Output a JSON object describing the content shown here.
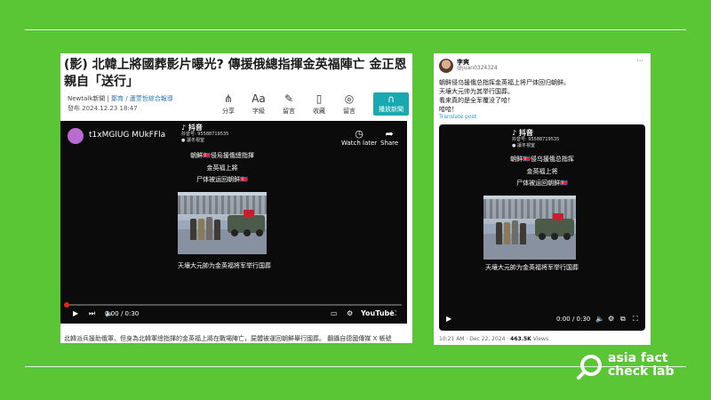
{
  "news": {
    "title": "(影) 北韓上將國葬影片曝光? 傳援俄總指揮金英福陣亡 金正恩親自「送行」",
    "source": "Newtalk新聞",
    "author_sep": " | ",
    "author": "鄭育 / 蘆萱哲綜合報導",
    "published": "發布 2024.12.23 18:47",
    "tools": [
      {
        "icon": "share-icon",
        "glyph": "⋔",
        "label": "分享"
      },
      {
        "icon": "font-size-icon",
        "glyph": "Aa",
        "label": "字級"
      },
      {
        "icon": "comment-icon",
        "glyph": "✎",
        "label": "留言"
      },
      {
        "icon": "bookmark-icon",
        "glyph": "▯",
        "label": "收藏"
      },
      {
        "icon": "message-icon",
        "glyph": "◎",
        "label": "留言"
      }
    ],
    "play_news": {
      "icon": "headphones-icon",
      "glyph": "∩",
      "label": "播放新聞"
    },
    "caption": "北韓派兵援助俄軍，但身為北韓軍總指揮的金英福上將在戰場陣亡，屍體被運回朝鮮舉行國葬。 翻攝自德國傳媒 X 帳號"
  },
  "youtube": {
    "channel": "t1xMGlUG MUkFFla",
    "watch_later": "Watch later",
    "share": "Share",
    "time": "0:00 / 0:30",
    "logo": "YouTube"
  },
  "video_overlay": {
    "platform": "抖音",
    "id_line": "抖音号: 95588719535",
    "sub_line": "● 讓冬視室",
    "caption_lines_trad": [
      "朝鮮🇰🇵侵烏援俄總指揮",
      "金英福上將",
      "尸体被运回朝鲜🇰🇵"
    ],
    "caption_lines_simp": [
      "朝鲜🇰🇵侵乌援俄总指挥",
      "金英福上将",
      "尸体被运回朝鲜🇰🇵"
    ],
    "bottom_caption": "天壤大元帥为金英福将军举行国葬"
  },
  "tweet": {
    "name": "李爽",
    "handle": "@juan0324324",
    "text_lines": [
      "朝鲜侵乌援俄总指挥金英福上将尸体回归朝鲜。",
      "天壤大元帅为其举行国葬。",
      "看来真的是全军覆没了哈！",
      "哈哈！"
    ],
    "translate": "Translate post",
    "time": "0:00 / 0:30",
    "footer_time": "10:21 AM · Dec 22, 2024 · ",
    "views_count": "463.5K",
    "views_label": " Views"
  },
  "logo": {
    "line1": "asia fact",
    "line2": "check lab"
  },
  "colors": {
    "background": "#5ac635",
    "accent_teal": "#1aa9b0",
    "youtube_red": "#e62117"
  }
}
